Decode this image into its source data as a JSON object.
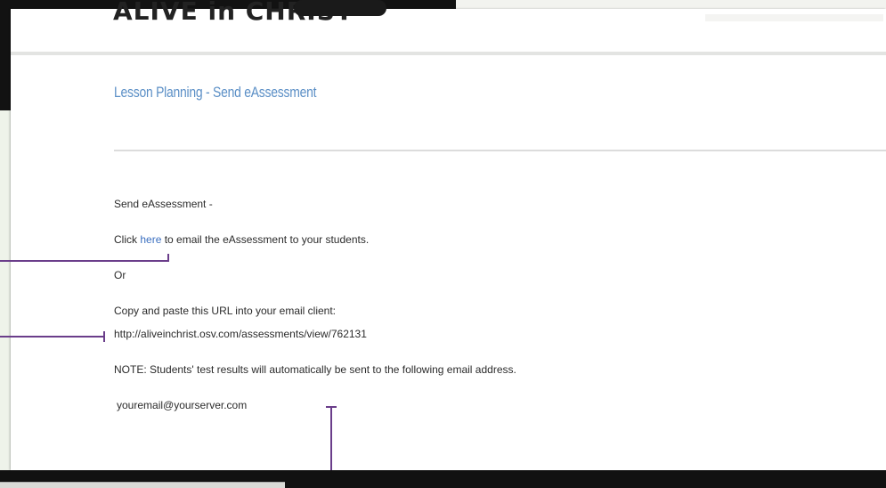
{
  "header": {
    "logo_text": "ALIVE in CHRIST"
  },
  "breadcrumb": "Lesson Planning - Send eAssessment",
  "content": {
    "heading": "Send eAssessment -",
    "click_prefix": "Click ",
    "here_link": "here",
    "click_suffix": " to email the eAssessment to your students.",
    "or_text": "Or",
    "copy_instruction": "Copy and paste this URL into your email client:",
    "url_text": "http://aliveinchrist.osv.com/assessments/view/762131",
    "note_text": "NOTE: Students' test results will automatically be sent to the following email address.",
    "email_text": "youremail@yourserver.com"
  },
  "colors": {
    "link": "#3b6fc0",
    "breadcrumb": "#5b8fc6",
    "callout": "#6a3d8a"
  }
}
